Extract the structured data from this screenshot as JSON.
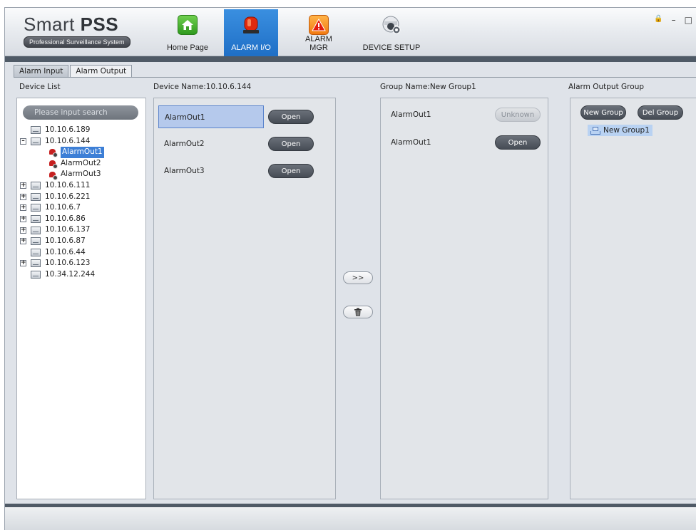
{
  "app": {
    "name_light": "Smart ",
    "name_bold": "PSS",
    "subtitle": "Professional Surveillance System"
  },
  "nav": [
    {
      "label": "Home Page",
      "icon": "home-icon"
    },
    {
      "label": "ALARM I/O",
      "icon": "alarm-light-icon",
      "active": true
    },
    {
      "label": "ALARM MGR",
      "icon": "warning-icon"
    },
    {
      "label": "DEVICE SETUP",
      "icon": "camera-gear-icon"
    }
  ],
  "window_controls": {
    "lock": "🔒",
    "minimize": "–",
    "maximize": "□"
  },
  "subtabs": [
    "Alarm Input",
    "Alarm Output"
  ],
  "labels": {
    "device_list": "Device List",
    "device_name": "Device Name:10.10.6.144",
    "group_name": "Group Name:New Group1",
    "alarm_output_group": "Alarm Output Group"
  },
  "search": {
    "placeholder": "Please input search"
  },
  "tree": [
    {
      "ip": "10.10.6.189",
      "expander": ""
    },
    {
      "ip": "10.10.6.144",
      "expander": "–"
    },
    {
      "ip": "10.10.6.111",
      "expander": "+"
    },
    {
      "ip": "10.10.6.221",
      "expander": "+"
    },
    {
      "ip": "10.10.6.7",
      "expander": "+"
    },
    {
      "ip": "10.10.6.86",
      "expander": "+"
    },
    {
      "ip": "10.10.6.137",
      "expander": "+"
    },
    {
      "ip": "10.10.6.87",
      "expander": "+"
    },
    {
      "ip": "10.10.6.44",
      "expander": ""
    },
    {
      "ip": "10.10.6.123",
      "expander": "+"
    },
    {
      "ip": "10.34.12.244",
      "expander": ""
    }
  ],
  "tree_children": [
    "AlarmOut1",
    "AlarmOut2",
    "AlarmOut3"
  ],
  "outputs": [
    {
      "name": "AlarmOut1",
      "state": "Open"
    },
    {
      "name": "AlarmOut2",
      "state": "Open"
    },
    {
      "name": "AlarmOut3",
      "state": "Open"
    }
  ],
  "move_buttons": {
    "add": ">>"
  },
  "group_items": [
    {
      "name": "AlarmOut1",
      "state": "Unknown"
    },
    {
      "name": "AlarmOut1",
      "state": "Open"
    }
  ],
  "group_buttons": {
    "new": "New Group",
    "del": "Del Group"
  },
  "groups": [
    "New Group1"
  ]
}
